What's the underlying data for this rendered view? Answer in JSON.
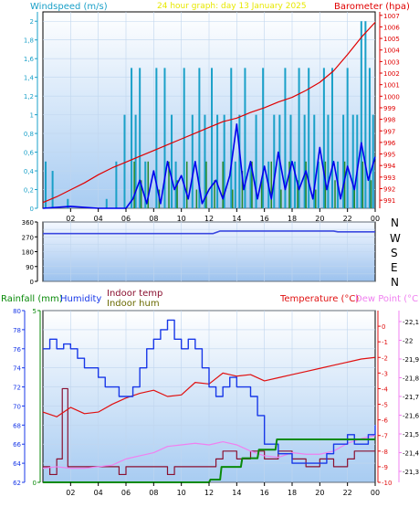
{
  "colors": {
    "plot_top": "#ffffff",
    "plot_bottom": "#9fc6f0",
    "wind": "#1aa0c8",
    "wind_avg": "#0000ee",
    "baro": "#e00000",
    "gust": "#2a8a2a",
    "dir": "#3a48e0",
    "rain": "#0a8a0a",
    "humidity": "#1838e8",
    "indoor_temp": "#8a1030",
    "indoor_hum": "#6a6a00",
    "temperature": "#e01010",
    "dewpoint": "#f080f0"
  },
  "header": {
    "windspeed_label": "Windspeed (m/s)",
    "date_title": "24 hour graph: day 13 January 2025",
    "barometer_label": "Barometer (hpa)"
  },
  "direction": {
    "compass": [
      "N",
      "W",
      "S",
      "E",
      "N"
    ]
  },
  "lower": {
    "rainfall_label": "Rainfall (mm)",
    "humidity_label": "Humidity",
    "indoor_temp_label": "Indoor temp",
    "indoor_hum_label": "Indoor hum",
    "temperature_label": "Temperature (°C)",
    "dewpoint_label": "Dew Point (°C)"
  },
  "chart_data": [
    {
      "type": "line",
      "title": "24 hour graph: day 13 January 2025",
      "x_ticks": [
        "02",
        "04",
        "06",
        "08",
        "10",
        "12",
        "14",
        "16",
        "18",
        "20",
        "22",
        "00"
      ],
      "y_left": {
        "label": "Windspeed (m/s)",
        "range": [
          0,
          2.1
        ],
        "ticks": [
          "0",
          "0,2",
          "0,4",
          "0,6",
          "0,8",
          "1",
          "1,2",
          "1,4",
          "1,6",
          "1,8",
          "2"
        ]
      },
      "y_right": {
        "label": "Barometer (hpa)",
        "range": [
          990.3,
          1007.3
        ],
        "ticks": [
          "991",
          "992",
          "993",
          "994",
          "995",
          "996",
          "997",
          "998",
          "999",
          "1000",
          "1001",
          "1002",
          "1003",
          "1004",
          "1005",
          "1006",
          "1007"
        ]
      },
      "series": [
        {
          "name": "Barometer (hpa)",
          "axis": "right",
          "x": [
            0,
            1,
            2,
            3,
            4,
            5,
            6,
            7,
            8,
            9,
            10,
            11,
            12,
            13,
            14,
            15,
            16,
            17,
            18,
            19,
            20,
            21,
            22,
            23,
            24
          ],
          "values": [
            990.8,
            991.3,
            991.9,
            992.5,
            993.2,
            993.8,
            994.3,
            994.8,
            995.3,
            995.8,
            996.3,
            996.8,
            997.3,
            997.8,
            998.1,
            998.6,
            999.0,
            999.5,
            999.9,
            1000.5,
            1001.2,
            1002.2,
            1003.6,
            1005.1,
            1006.4
          ]
        },
        {
          "name": "Windspeed gust",
          "axis": "left",
          "x": [
            0.2,
            0.7,
            1.8,
            4.6,
            5.3,
            5.9,
            6.4,
            6.7,
            7.0,
            7.4,
            8.2,
            8.8,
            9.3,
            9.6,
            10.2,
            10.8,
            11.3,
            11.7,
            12.2,
            12.6,
            13.1,
            13.6,
            13.9,
            14.2,
            14.6,
            15.0,
            15.4,
            15.9,
            16.3,
            16.7,
            17.1,
            17.5,
            17.9,
            18.2,
            18.5,
            18.9,
            19.2,
            19.6,
            19.9,
            20.3,
            20.6,
            20.9,
            21.3,
            21.7,
            22.0,
            22.4,
            22.7,
            23.0,
            23.3,
            23.6,
            23.85
          ],
          "values": [
            0.5,
            0.4,
            0.1,
            0.1,
            0.5,
            1.0,
            1.5,
            1.0,
            1.5,
            0.5,
            1.5,
            1.5,
            1.0,
            0.5,
            1.5,
            1.0,
            1.5,
            1.0,
            1.5,
            1.0,
            1.0,
            1.5,
            0.5,
            1.0,
            1.5,
            0.5,
            1.0,
            1.5,
            0.5,
            1.0,
            1.0,
            1.5,
            1.0,
            0.5,
            1.5,
            1.0,
            1.5,
            1.0,
            0.5,
            1.5,
            1.0,
            1.5,
            0.5,
            1.0,
            1.5,
            1.0,
            1.0,
            2.0,
            2.0,
            1.5,
            1.0
          ]
        },
        {
          "name": "Windspeed avg",
          "axis": "left",
          "x": [
            0,
            2,
            4,
            6,
            6.5,
            7.0,
            7.5,
            8.0,
            8.5,
            9.0,
            9.5,
            10.0,
            10.5,
            11.0,
            11.5,
            12.0,
            12.5,
            13.0,
            13.5,
            14.0,
            14.5,
            15.0,
            15.5,
            16.0,
            16.5,
            17.0,
            17.5,
            18.0,
            18.5,
            19.0,
            19.5,
            20.0,
            20.5,
            21.0,
            21.5,
            22.0,
            22.5,
            23.0,
            23.5,
            24.0
          ],
          "values": [
            0,
            0.02,
            0,
            0,
            0.1,
            0.3,
            0.05,
            0.4,
            0.05,
            0.5,
            0.2,
            0.35,
            0.1,
            0.5,
            0.05,
            0.2,
            0.3,
            0.1,
            0.35,
            0.9,
            0.2,
            0.5,
            0.1,
            0.45,
            0.1,
            0.6,
            0.2,
            0.5,
            0.2,
            0.4,
            0.1,
            0.65,
            0.2,
            0.5,
            0.1,
            0.45,
            0.2,
            0.7,
            0.3,
            0.55
          ]
        },
        {
          "name": "Wind gust low",
          "axis": "left",
          "x": [
            6.6,
            7.1,
            7.6,
            8.4,
            9.1,
            9.7,
            10.4,
            11.1,
            11.8,
            12.4,
            13.0,
            13.7,
            14.4,
            15.1,
            15.8,
            16.5,
            17.2,
            17.8,
            18.4,
            19.0,
            19.7,
            20.4,
            21.1,
            21.8,
            22.5,
            23.1,
            23.7
          ],
          "values": [
            0.5,
            0.3,
            0.5,
            0.2,
            0.5,
            0.3,
            0.5,
            0.2,
            0.5,
            0.3,
            0.5,
            0.2,
            0.4,
            0.5,
            0.3,
            0.5,
            0.2,
            0.5,
            0.3,
            0.5,
            0.2,
            0.5,
            0.3,
            0.5,
            0.2,
            0.5,
            0.3
          ]
        }
      ]
    },
    {
      "type": "line",
      "title": "",
      "x_ticks": [],
      "y_left": {
        "label": "",
        "range": [
          0,
          360
        ],
        "ticks": [
          "0",
          "45",
          "90",
          "135",
          "180",
          "225",
          "270",
          "315",
          "360"
        ]
      },
      "compass_labels": [
        "N",
        "W",
        "S",
        "E",
        "N"
      ],
      "series": [
        {
          "name": "Wind direction",
          "x": [
            0,
            12.3,
            12.8,
            21.0,
            21.3,
            24
          ],
          "values": [
            290,
            290,
            305,
            305,
            300,
            300
          ]
        }
      ]
    },
    {
      "type": "line",
      "title": "",
      "x_ticks": [
        "02",
        "04",
        "06",
        "08",
        "10",
        "12",
        "14",
        "16",
        "18",
        "20",
        "22",
        "00"
      ],
      "y_left_inner": {
        "label": "Rainfall (mm)",
        "range": [
          0,
          5
        ],
        "ticks": [
          "0",
          "5"
        ]
      },
      "y_left": {
        "label": "Humidity",
        "range": [
          62,
          80
        ],
        "ticks": [
          "62",
          "64",
          "66",
          "68",
          "70",
          "72",
          "74",
          "76",
          "78",
          "80"
        ]
      },
      "y_right": {
        "label": "Temperature (°C)",
        "range": [
          -10,
          1
        ],
        "ticks": [
          "0",
          "-1",
          "-2",
          "-3",
          "-4",
          "-5",
          "-6",
          "-7",
          "-8",
          "-9",
          "-10"
        ]
      },
      "y_right_inner": {
        "label": "Dew Point (°C)",
        "range": [
          -21.3,
          -22.1
        ],
        "ticks": [
          "-22,1",
          "-22",
          "-21,9",
          "-21,8",
          "-21,7",
          "-21,6",
          "-21,5",
          "-21,4",
          "-21,3"
        ]
      },
      "series": [
        {
          "name": "Humidity",
          "axis": "left",
          "x": [
            0,
            0.5,
            1.0,
            1.5,
            2.0,
            2.5,
            3.0,
            3.5,
            4.0,
            4.5,
            5.0,
            5.5,
            6.0,
            6.5,
            7.0,
            7.5,
            8.0,
            8.5,
            9.0,
            9.5,
            10.0,
            10.5,
            11.0,
            11.5,
            12.0,
            12.5,
            13.0,
            13.5,
            14.0,
            14.5,
            15.0,
            15.5,
            16.0,
            16.5,
            17.0,
            17.5,
            18.0,
            18.5,
            19.0,
            19.5,
            20.0,
            20.5,
            21.0,
            21.5,
            22.0,
            22.5,
            23.0,
            23.5,
            24.0
          ],
          "values": [
            76,
            77,
            76,
            76.5,
            76,
            75,
            74,
            74,
            73,
            72,
            72,
            71,
            71,
            72,
            74,
            76,
            77,
            78,
            79,
            77,
            76,
            77,
            76,
            74,
            72,
            71,
            72,
            73,
            72,
            72,
            71,
            69,
            66,
            66,
            65,
            65,
            64,
            64,
            64,
            64,
            64,
            65,
            66,
            66,
            67,
            66,
            66,
            67,
            68
          ]
        },
        {
          "name": "Indoor temp",
          "axis": "right",
          "x": [
            0,
            0.5,
            1.0,
            1.4,
            1.8,
            2.2,
            2.8,
            3.5,
            4.0,
            4.5,
            5.0,
            5.5,
            6.0,
            6.5,
            7.0,
            7.5,
            8.0,
            8.5,
            9.0,
            9.5,
            10.0,
            10.5,
            11.0,
            11.5,
            12.0,
            12.5,
            13.0,
            13.5,
            14.0,
            14.5,
            15.0,
            15.5,
            16.0,
            16.5,
            17.0,
            17.5,
            18.0,
            18.5,
            19.0,
            19.5,
            20.0,
            20.5,
            21.0,
            21.5,
            22.0,
            22.5,
            23.0,
            23.5,
            24.0
          ],
          "values": [
            -9,
            -9.5,
            -8.5,
            -4,
            -9,
            -9,
            -9,
            -9,
            -9,
            -9,
            -9,
            -9.5,
            -9,
            -9,
            -9,
            -9,
            -9,
            -9,
            -9.5,
            -9,
            -9,
            -9,
            -9,
            -9,
            -9,
            -8.5,
            -8,
            -8,
            -8.5,
            -8.5,
            -8,
            -8,
            -8.5,
            -8.5,
            -8,
            -8,
            -8.5,
            -8.5,
            -9,
            -9,
            -8.5,
            -8.5,
            -9,
            -9,
            -8.5,
            -8,
            -8,
            -8,
            -8
          ]
        },
        {
          "name": "Temperature",
          "axis": "right",
          "x": [
            0,
            1,
            2,
            3,
            4,
            5,
            6,
            7,
            8,
            9,
            10,
            11,
            12,
            13,
            14,
            15,
            16,
            17,
            18,
            19,
            20,
            21,
            22,
            23,
            24
          ],
          "values": [
            -5.5,
            -5.8,
            -5.2,
            -5.6,
            -5.5,
            -5.0,
            -4.6,
            -4.3,
            -4.1,
            -4.5,
            -4.4,
            -3.6,
            -3.7,
            -3.0,
            -3.2,
            -3.1,
            -3.5,
            -3.3,
            -3.1,
            -2.9,
            -2.7,
            -2.5,
            -2.3,
            -2.1,
            -2.0
          ]
        },
        {
          "name": "Dew Point",
          "axis": "right",
          "x": [
            0,
            1,
            2,
            3,
            4,
            5,
            6,
            7,
            8,
            9,
            10,
            11,
            12,
            13,
            14,
            15,
            16,
            17,
            18,
            19,
            20,
            21,
            22,
            23,
            24
          ],
          "values": [
            -9.1,
            -9.0,
            -9.1,
            -9.1,
            -9.0,
            -8.9,
            -8.5,
            -8.3,
            -8.1,
            -7.7,
            -7.6,
            -7.5,
            -7.6,
            -7.4,
            -7.6,
            -8.0,
            -8.3,
            -8.4,
            -8.1,
            -8.2,
            -8.2,
            -8.0,
            -7.5,
            -7.2,
            -7.0
          ]
        },
        {
          "name": "Rainfall",
          "axis": "rain",
          "x": [
            0,
            10.5,
            12.0,
            12.1,
            12.8,
            12.9,
            14.3,
            14.4,
            15.5,
            15.6,
            16.8,
            16.9,
            22.6,
            22.7,
            24.0
          ],
          "values": [
            0,
            0,
            0,
            0.08,
            0.08,
            0.45,
            0.45,
            0.7,
            0.7,
            0.95,
            0.95,
            1.25,
            1.25,
            1.25,
            1.25
          ]
        }
      ]
    }
  ]
}
